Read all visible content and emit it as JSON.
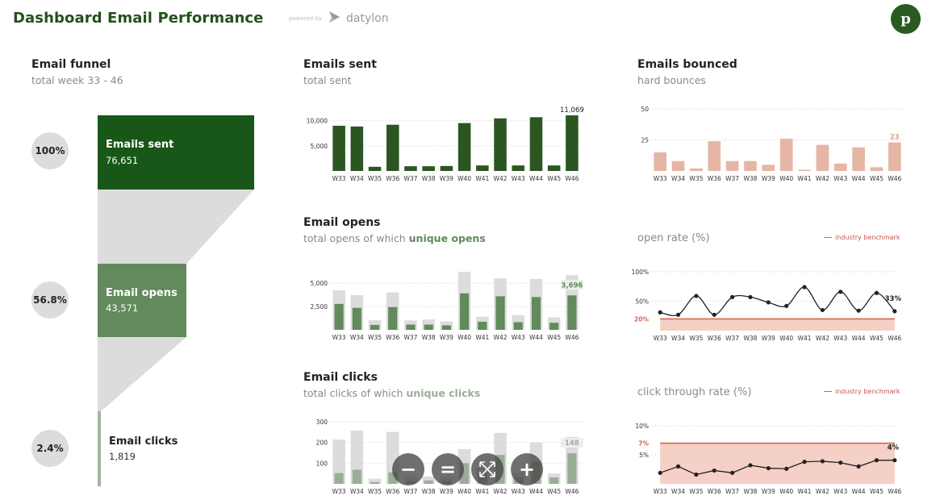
{
  "header": {
    "title": "Dashboard Email Performance",
    "powered_by": "powered by",
    "brand": "datylon",
    "avatar_letter": "p"
  },
  "colors": {
    "title": "#24501c",
    "sent": "#2b5621",
    "funnel_sent": "#185717",
    "funnel_opens": "#628a5c",
    "funnel_clicks": "#a3b59f",
    "opens_unique": "#628a5c",
    "clicks_unique": "#9aae97",
    "total_bar": "#dcdcdc",
    "bounce": "#e5b5a6",
    "benchmark_line": "#d9644e",
    "benchmark_fill": "#f5d0c6",
    "rate_line": "#222222"
  },
  "funnel": {
    "title": "Email funnel",
    "subtitle": "total week 33 - 46",
    "stages": [
      {
        "label": "Emails sent",
        "value": "76,651",
        "pct": "100%",
        "raw": 76651
      },
      {
        "label": "Email opens",
        "value": "43,571",
        "pct": "56.8%",
        "raw": 43571
      },
      {
        "label": "Email clicks",
        "value": "1,819",
        "pct": "2.4%",
        "raw": 1819
      }
    ]
  },
  "sections": {
    "sent": {
      "title": "Emails sent",
      "subtitle": "total sent"
    },
    "bounced": {
      "title": "Emails bounced",
      "subtitle": "hard bounces"
    },
    "opens": {
      "title": "Email opens",
      "subtitle_prefix": "total opens of which ",
      "subtitle_highlight": "unique opens"
    },
    "open_rate": {
      "title": "open rate (%)",
      "legend": "industry benchmark"
    },
    "clicks": {
      "title": "Email clicks",
      "subtitle_prefix": "total clicks of which ",
      "subtitle_highlight": "unique clicks"
    },
    "ctr": {
      "title": "click through rate (%)",
      "legend": "industry benchmark"
    }
  },
  "zoom_controls": [
    {
      "name": "zoom-out-button",
      "icon": "minus-icon",
      "glyph": "−"
    },
    {
      "name": "zoom-reset-button",
      "icon": "equals-icon",
      "glyph": "="
    },
    {
      "name": "fit-screen-button",
      "icon": "expand-icon",
      "glyph": "⤢"
    },
    {
      "name": "zoom-in-button",
      "icon": "plus-icon",
      "glyph": "+"
    }
  ],
  "chart_data": [
    {
      "id": "sent",
      "type": "bar",
      "title": "Emails sent",
      "categories": [
        "W33",
        "W34",
        "W35",
        "W36",
        "W37",
        "W38",
        "W39",
        "W40",
        "W41",
        "W42",
        "W43",
        "W44",
        "W45",
        "W46"
      ],
      "values": [
        9000,
        8850,
        830,
        9200,
        940,
        940,
        990,
        9530,
        1100,
        10470,
        1100,
        10700,
        1100,
        11069
      ],
      "yticks": [
        {
          "v": 5000,
          "label": "5,000"
        },
        {
          "v": 10000,
          "label": "10,000"
        }
      ],
      "ylim": [
        0,
        12200
      ],
      "last_label": "11,069"
    },
    {
      "id": "bounced",
      "type": "bar",
      "title": "Emails bounced",
      "categories": [
        "W33",
        "W34",
        "W35",
        "W36",
        "W37",
        "W38",
        "W39",
        "W40",
        "W41",
        "W42",
        "W43",
        "W44",
        "W45",
        "W46"
      ],
      "values": [
        15,
        8,
        2,
        24,
        8,
        8,
        5,
        26,
        1,
        21,
        6,
        19,
        3,
        23
      ],
      "yticks": [
        {
          "v": 25,
          "label": "25"
        },
        {
          "v": 50,
          "label": "50"
        }
      ],
      "ylim": [
        0,
        52
      ],
      "last_label": "23"
    },
    {
      "id": "opens",
      "type": "bar",
      "title": "Email opens",
      "categories": [
        "W33",
        "W34",
        "W35",
        "W36",
        "W37",
        "W38",
        "W39",
        "W40",
        "W41",
        "W42",
        "W43",
        "W44",
        "W45",
        "W46"
      ],
      "series": [
        {
          "name": "total opens",
          "values": [
            4240,
            3730,
            1040,
            4020,
            1010,
            1110,
            900,
            6220,
            1400,
            5520,
            1580,
            5470,
            1350,
            5860
          ]
        },
        {
          "name": "unique opens",
          "values": [
            2780,
            2360,
            530,
            2440,
            560,
            560,
            480,
            3910,
            870,
            3600,
            820,
            3520,
            760,
            3696
          ]
        }
      ],
      "yticks": [
        {
          "v": 2500,
          "label": "2,500"
        },
        {
          "v": 5000,
          "label": "5,000"
        }
      ],
      "ylim": [
        0,
        6400
      ],
      "last_label": "3,696"
    },
    {
      "id": "open_rate",
      "type": "line",
      "title": "open rate (%)",
      "categories": [
        "W33",
        "W34",
        "W35",
        "W36",
        "W37",
        "W38",
        "W39",
        "W40",
        "W41",
        "W42",
        "W43",
        "W44",
        "W45",
        "W46"
      ],
      "values": [
        31,
        27,
        59,
        27,
        57,
        57,
        48,
        42,
        74,
        35,
        66,
        34,
        64,
        33
      ],
      "benchmark": 20,
      "benchmark_label": "20%",
      "yticks": [
        {
          "v": 50,
          "label": "50%"
        },
        {
          "v": 100,
          "label": "100%"
        }
      ],
      "ylim": [
        0,
        100
      ],
      "last_label": "33%"
    },
    {
      "id": "clicks",
      "type": "bar",
      "title": "Email clicks",
      "categories": [
        "W33",
        "W34",
        "W35",
        "W36",
        "W37",
        "W38",
        "W39",
        "W40",
        "W41",
        "W42",
        "W43",
        "W44",
        "W45",
        "W46"
      ],
      "series": [
        {
          "name": "total clicks",
          "values": [
            214,
            258,
            25,
            251,
            35,
            36,
            30,
            168,
            80,
            246,
            55,
            200,
            50,
            227
          ]
        },
        {
          "name": "unique clicks",
          "values": [
            52,
            68,
            9,
            56,
            12,
            17,
            13,
            100,
            49,
            140,
            30,
            107,
            31,
            148
          ]
        }
      ],
      "yticks": [
        {
          "v": 100,
          "label": "100"
        },
        {
          "v": 200,
          "label": "200"
        },
        {
          "v": 300,
          "label": "300"
        }
      ],
      "ylim": [
        0,
        300
      ],
      "last_label": "148"
    },
    {
      "id": "ctr",
      "type": "line",
      "title": "click through rate (%)",
      "categories": [
        "W33",
        "W34",
        "W35",
        "W36",
        "W37",
        "W38",
        "W39",
        "W40",
        "W41",
        "W42",
        "W43",
        "W44",
        "W45",
        "W46"
      ],
      "values": [
        1.9,
        3.0,
        1.6,
        2.3,
        1.9,
        3.2,
        2.7,
        2.6,
        3.8,
        3.9,
        3.65,
        3.0,
        4.07,
        4.07
      ],
      "benchmark": 7,
      "benchmark_label": "7%",
      "yticks": [
        {
          "v": 5,
          "label": "5%"
        },
        {
          "v": 10,
          "label": "10%"
        }
      ],
      "ylim": [
        0,
        10
      ],
      "last_label": "4%"
    }
  ]
}
